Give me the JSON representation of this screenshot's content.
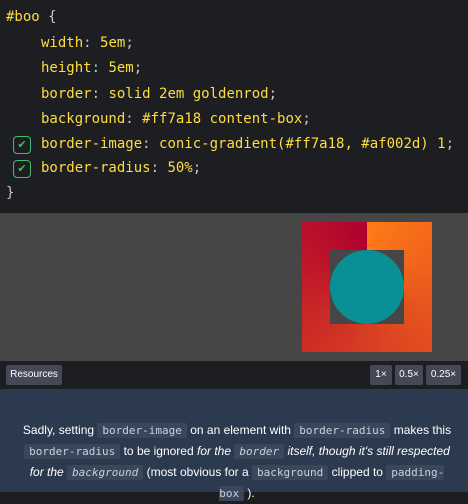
{
  "code": {
    "selector": "#boo",
    "open_brace": " {",
    "close_brace": "}",
    "lines": [
      {
        "prop": "width",
        "value": "5em"
      },
      {
        "prop": "height",
        "value": "5em"
      },
      {
        "prop": "border",
        "value": "solid 2em goldenrod"
      },
      {
        "prop": "background",
        "value": "#ff7a18 content-box"
      },
      {
        "prop": "border-image",
        "value": "conic-gradient(#ff7a18, #af002d) 1",
        "checked": true
      },
      {
        "prop": "border-radius",
        "value": "50%",
        "checked": true
      }
    ]
  },
  "toolbar": {
    "resources_label": "Resources",
    "zoom_options": [
      "1×",
      "0.5×",
      "0.25×"
    ]
  },
  "description": {
    "t1": "Sadly, setting ",
    "c1": "border-image",
    "t2": " on an element with ",
    "c2": "border-radius",
    "t3": " makes this ",
    "c3": "border-radius",
    "t4": " to be ignored ",
    "i1": "for the ",
    "c4": "border",
    "i2": " itself, though it's still respected for the ",
    "c5": "background",
    "t5": " (most obvious for a ",
    "c6": "background",
    "t6": " clipped to ",
    "c7": "padding-box",
    "t7": " )."
  },
  "colors": {
    "gradient_start": "#ff7a18",
    "gradient_end": "#af002d",
    "circle": "#0a8f94",
    "check_accent": "#3fbf6b"
  },
  "icons": [
    "checkmark-icon"
  ]
}
